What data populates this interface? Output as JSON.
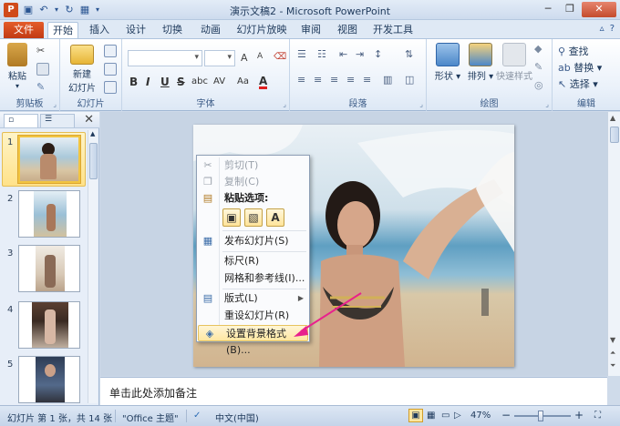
{
  "window": {
    "title": "演示文稿2 - Microsoft PowerPoint",
    "controls": {
      "help": "?"
    }
  },
  "tabs": [
    "文件",
    "开始",
    "插入",
    "设计",
    "切换",
    "动画",
    "幻灯片放映",
    "审阅",
    "视图",
    "开发工具"
  ],
  "ribbon": {
    "clipboard": {
      "label": "剪贴板",
      "paste": "粘贴"
    },
    "slides": {
      "label": "幻灯片",
      "new_slide_line1": "新建",
      "new_slide_line2": "幻灯片"
    },
    "font": {
      "label": "字体",
      "bold": "B",
      "italic": "I",
      "underline": "U",
      "strike": "S",
      "shadow": "abc",
      "spacing": "AV",
      "case": "Aa",
      "color": "A"
    },
    "paragraph": {
      "label": "段落"
    },
    "drawing": {
      "label": "绘图",
      "shapes": "形状",
      "arrange": "排列",
      "quick_styles": "快速样式"
    },
    "editing": {
      "label": "编辑",
      "find": "查找",
      "replace": "替换",
      "select": "选择"
    }
  },
  "thumbnails": [
    {
      "num": "1",
      "selected": true
    },
    {
      "num": "2",
      "selected": false
    },
    {
      "num": "3",
      "selected": false
    },
    {
      "num": "4",
      "selected": false
    },
    {
      "num": "5",
      "selected": false
    }
  ],
  "context_menu": {
    "cut": "剪切(T)",
    "copy": "复制(C)",
    "paste_options": "粘贴选项:",
    "publish": "发布幻灯片(S)",
    "ruler": "标尺(R)",
    "grid": "网格和参考线(I)...",
    "layout": "版式(L)",
    "reset": "重设幻灯片(R)",
    "format_bg": "设置背景格式(B)..."
  },
  "notes": {
    "placeholder": "单击此处添加备注"
  },
  "status": {
    "slide_info": "幻灯片 第 1 张，共 14 张",
    "theme": "\"Office 主题\"",
    "language": "中文(中国)",
    "zoom": "47%"
  },
  "colors": {
    "file_tab": "#c13a14",
    "highlight": "#ffe7a1",
    "arrow": "#e8218d"
  }
}
